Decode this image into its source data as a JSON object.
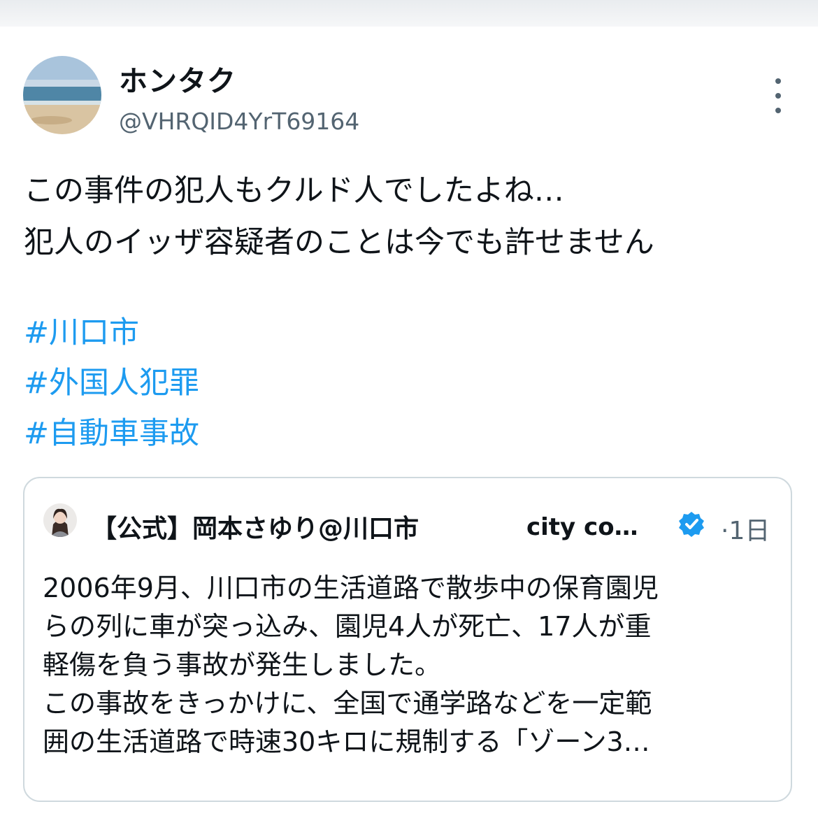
{
  "author": {
    "name": "ホンタク",
    "handle": "@VHRQID4YrT69164"
  },
  "tweet": {
    "lines": [
      "この事件の犯人もクルド人でしたよね…",
      "犯人のイッザ容疑者のことは今でも許せません"
    ],
    "hashtags": [
      "#川口市",
      "#外国人犯罪",
      "#自動車事故"
    ]
  },
  "quoted": {
    "name": "【公式】岡本さゆり@川口市",
    "name_suffix": "city co…",
    "time": "·1日",
    "text_lines": [
      "2006年9月、川口市の生活道路で散歩中の保育園児",
      "らの列に車が突っ込み、園児4人が死亡、17人が重",
      "軽傷を負う事故が発生しました。",
      "この事故をきっかけに、全国で通学路などを一定範",
      "囲の生活道路で時速30キロに規制する「ゾーン3…"
    ]
  },
  "icons": {
    "more": "more-vertical-icon",
    "verified": "verified-badge-icon"
  },
  "colors": {
    "link": "#1d9bf0",
    "secondary_text": "#536471",
    "border": "#cfd9de"
  }
}
